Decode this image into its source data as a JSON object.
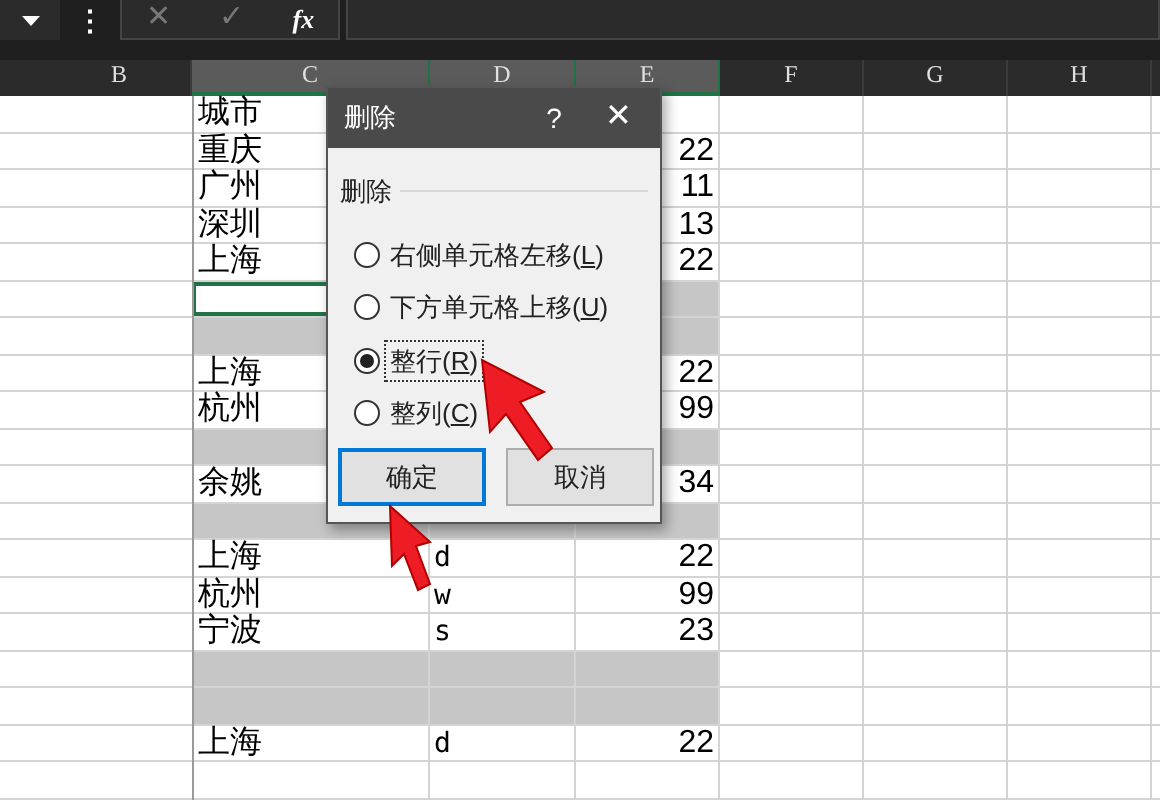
{
  "formula_bar": {
    "name_box_menu": "⋮",
    "cancel": "✕",
    "enter": "✓",
    "function": "fx"
  },
  "columns": [
    {
      "label": "B",
      "selected": false
    },
    {
      "label": "C",
      "selected": true
    },
    {
      "label": "D",
      "selected": true
    },
    {
      "label": "E",
      "selected": true
    },
    {
      "label": "F",
      "selected": false
    },
    {
      "label": "G",
      "selected": false
    },
    {
      "label": "H",
      "selected": false
    }
  ],
  "rows": [
    {
      "kind": "data",
      "c": "城市"
    },
    {
      "kind": "data",
      "c": "重庆",
      "e": "22"
    },
    {
      "kind": "data",
      "c": "广州",
      "e": "11"
    },
    {
      "kind": "data",
      "c": "深圳",
      "e": "13"
    },
    {
      "kind": "data",
      "c": "上海",
      "e": "22"
    },
    {
      "kind": "active"
    },
    {
      "kind": "gray"
    },
    {
      "kind": "data",
      "c": "上海",
      "e": "22"
    },
    {
      "kind": "data",
      "c": "杭州",
      "e": "99"
    },
    {
      "kind": "gray"
    },
    {
      "kind": "data",
      "c": "余姚",
      "e": "34"
    },
    {
      "kind": "gray"
    },
    {
      "kind": "data",
      "c": "上海",
      "d": "d",
      "e": "22"
    },
    {
      "kind": "data",
      "c": "杭州",
      "d": "w",
      "e": "99"
    },
    {
      "kind": "data",
      "c": "宁波",
      "d": "s",
      "e": "23"
    },
    {
      "kind": "gray"
    },
    {
      "kind": "gray"
    },
    {
      "kind": "data",
      "c": "上海",
      "d": "d",
      "e": "22"
    },
    {
      "kind": "data"
    }
  ],
  "dialog": {
    "title": "删除",
    "help": "?",
    "close": "✕",
    "group_label": "删除",
    "options": [
      {
        "label": "右侧单元格左移(",
        "key": "L",
        "end": ")",
        "selected": false,
        "focused": false
      },
      {
        "label": "下方单元格上移(",
        "key": "U",
        "end": ")",
        "selected": false,
        "focused": false
      },
      {
        "label": "整行(",
        "key": "R",
        "end": ")",
        "selected": true,
        "focused": true
      },
      {
        "label": "整列(",
        "key": "C",
        "end": ")",
        "selected": false,
        "focused": false
      }
    ],
    "buttons": [
      {
        "label": "确定",
        "default": true
      },
      {
        "label": "取消",
        "default": false
      }
    ]
  }
}
